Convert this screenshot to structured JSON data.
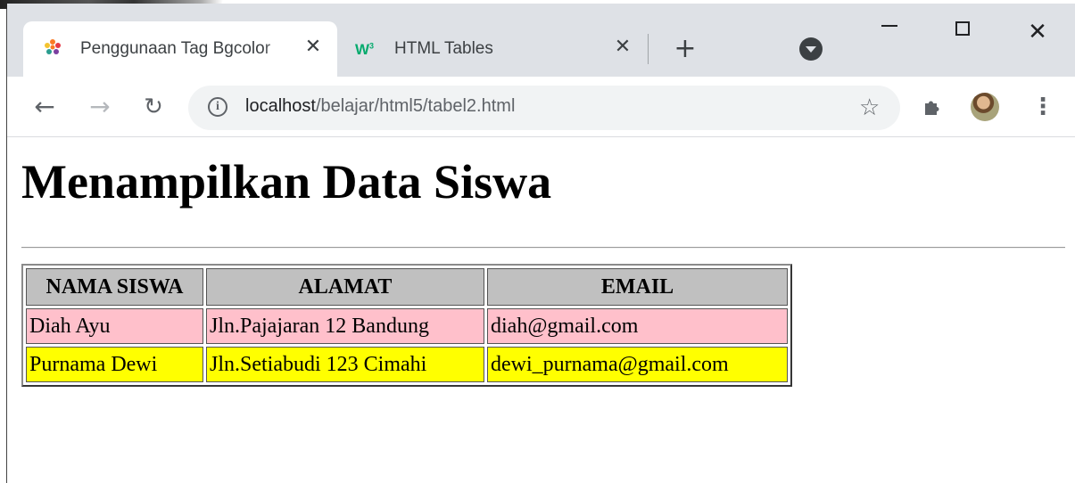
{
  "browser": {
    "tabs": [
      {
        "title": "Penggunaan Tag Bgcolor",
        "active": true,
        "favicon": "xampp-icon"
      },
      {
        "title": "HTML Tables",
        "active": false,
        "favicon": "w3schools-icon",
        "favicon_text": "W"
      }
    ],
    "new_tab_label": "+",
    "close_symbol": "✕",
    "address": {
      "host": "localhost",
      "path": "/belajar/html5/tabel2.html"
    },
    "icons": [
      "back-arrow-icon",
      "forward-arrow-icon",
      "reload-icon",
      "info-icon",
      "star-icon",
      "extensions-icon",
      "avatar",
      "menu-icon",
      "tab-search-icon",
      "minimize-icon",
      "maximize-icon",
      "close-icon"
    ]
  },
  "page": {
    "heading": "Menampilkan Data Siswa",
    "table": {
      "headers": [
        "NAMA SISWA",
        "ALAMAT",
        "EMAIL"
      ],
      "header_bg": "#c0c0c0",
      "rows": [
        {
          "cells": [
            "Diah Ayu",
            "Jln.Pajajaran 12 Bandung",
            "diah@gmail.com"
          ],
          "bgcolor": "#ffc0cb"
        },
        {
          "cells": [
            "Purnama Dewi",
            "Jln.Setiabudi 123 Cimahi",
            "dewi_purnama@gmail.com"
          ],
          "bgcolor": "#ffff00"
        }
      ]
    }
  }
}
